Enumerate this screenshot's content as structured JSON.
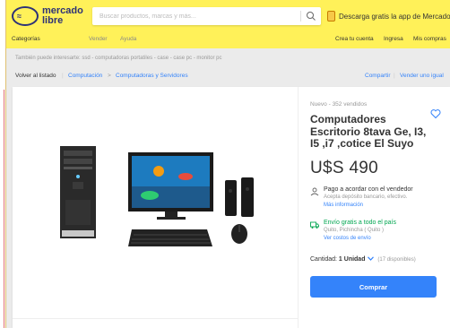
{
  "header": {
    "logo_line1": "mercado",
    "logo_line2": "libre",
    "search_placeholder": "Buscar productos, marcas y más...",
    "app_promo": "Descarga gratis la app de Mercado Libre"
  },
  "nav": {
    "categories": "Categorías",
    "sell": "Vender",
    "help": "Ayuda",
    "create_account": "Crea tu cuenta",
    "login": "Ingresa",
    "purchases": "Mis compras"
  },
  "also_interested": "También puede interesarte: ssd - computadoras portatiles - case - case pc - monitor pc",
  "breadcrumb": {
    "back": "Volver al listado",
    "items": [
      "Computación",
      "Computadoras y Servidores"
    ],
    "separator": ">",
    "share": "Compartir",
    "sell_same": "Vender uno igual"
  },
  "product": {
    "condition": "Nuevo  -  352 vendidos",
    "title": "Computadores Escritorio 8tava Ge, I3, I5 ,i7 ,cotice El Suyo",
    "price": "U$S 490",
    "payment": {
      "title": "Pago a acordar con el vendedor",
      "detail": "Acepta depósito bancario, efectivo.",
      "link": "Más información"
    },
    "shipping": {
      "title": "Envío gratis a todo el país",
      "location": "Quito, Pichincha ( Quito )",
      "link": "Ver costos de envío"
    },
    "quantity_label": "Cantidad:",
    "quantity_value": "1 Unidad",
    "available": "(17 disponibles)",
    "buy_label": "Comprar"
  },
  "colors": {
    "brand_yellow": "#fff159",
    "accent_blue": "#3483fa",
    "shipping_green": "#00a650"
  },
  "icons": [
    "search-icon",
    "phone-icon",
    "heart-icon",
    "payment-icon",
    "truck-icon",
    "chevron-down-icon"
  ]
}
